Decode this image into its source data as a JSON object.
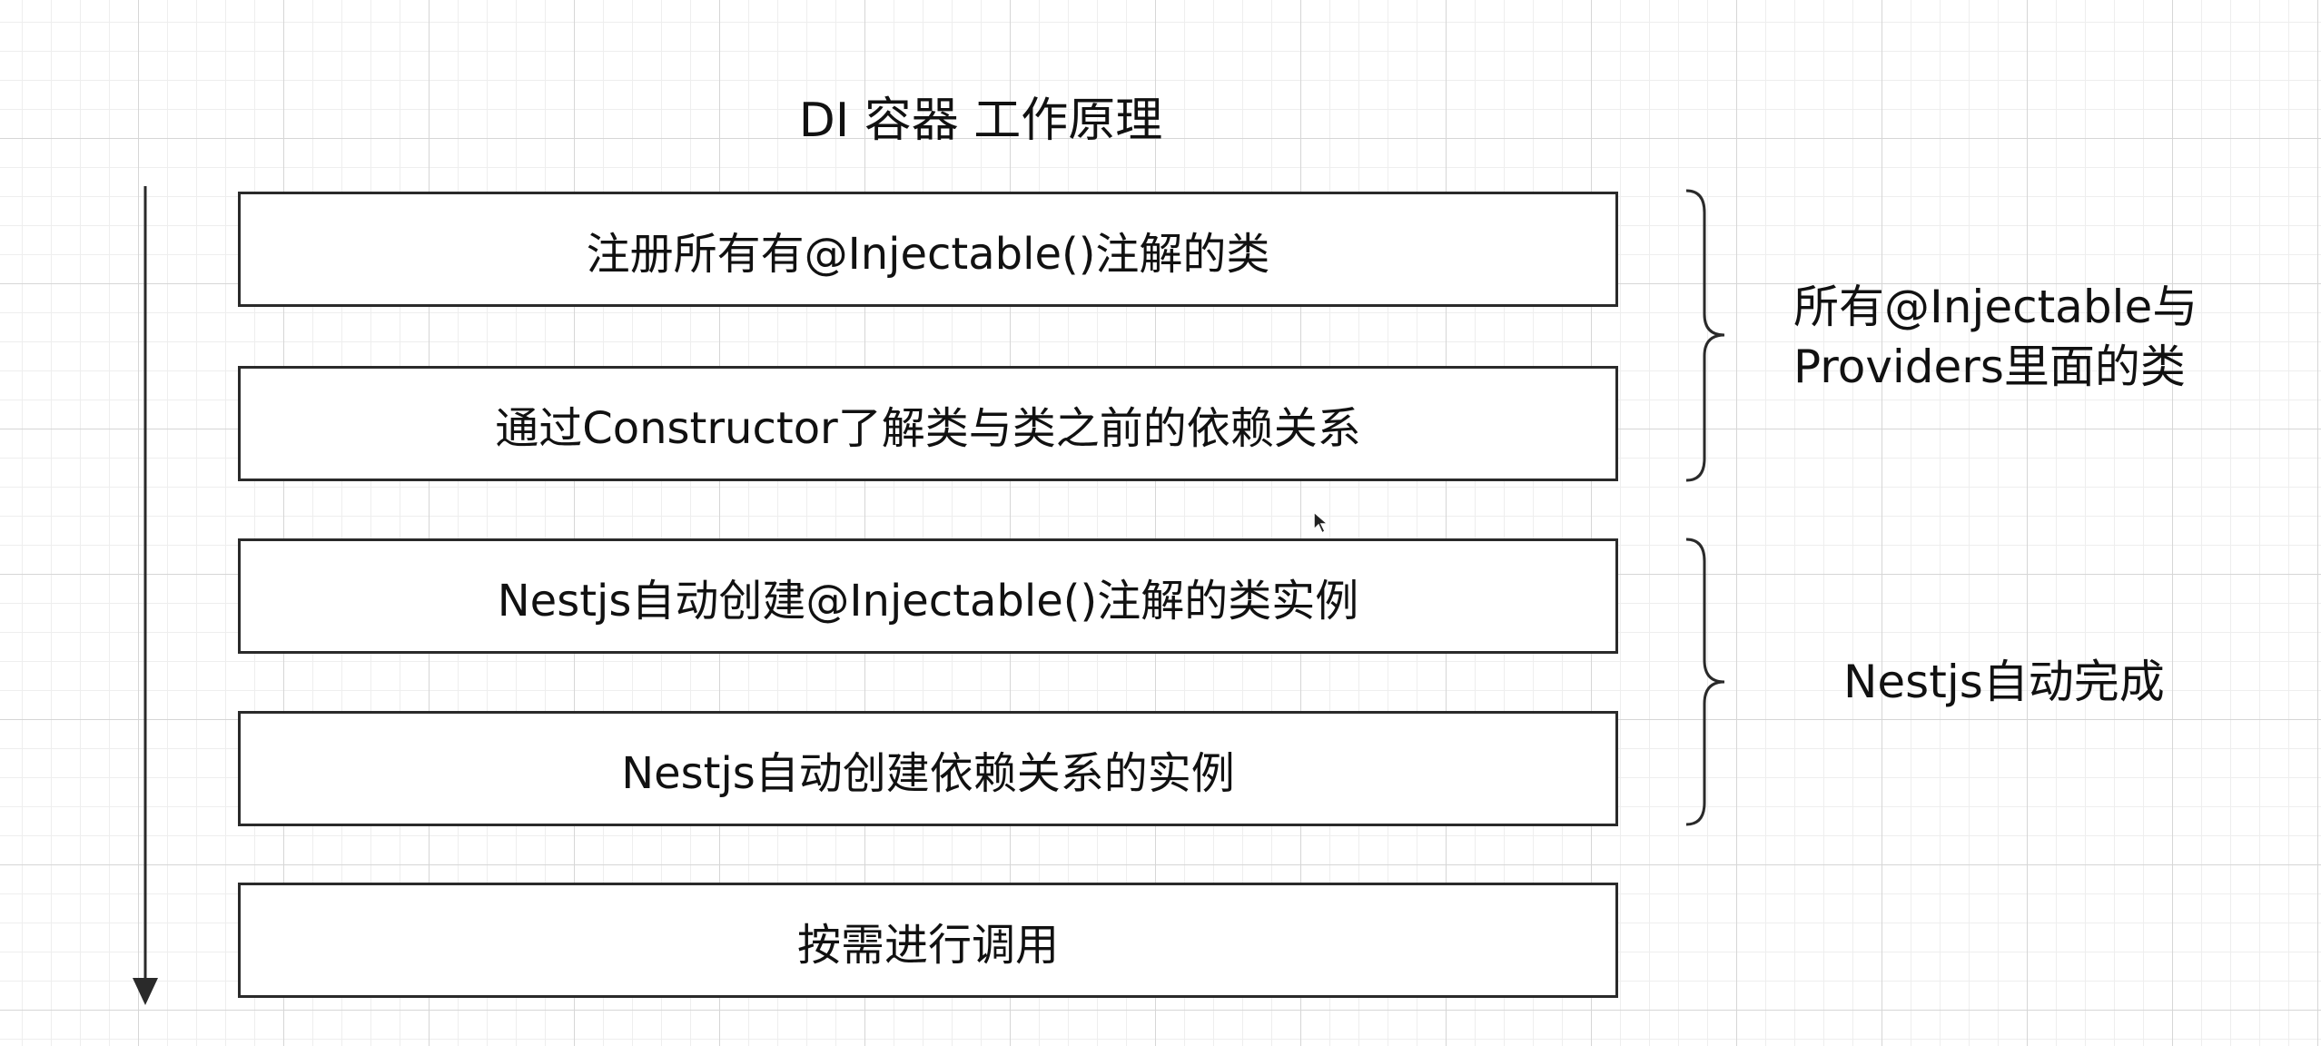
{
  "title": "DI 容器 工作原理",
  "steps": [
    "注册所有有@Injectable()注解的类",
    "通过Constructor了解类与类之前的依赖关系",
    "Nestjs自动创建@Injectable()注解的类实例",
    "Nestjs自动创建依赖关系的实例",
    "按需进行调用"
  ],
  "groups": [
    {
      "label_line1": "所有@Injectable与",
      "label_line2": "Providers里面的类"
    },
    {
      "label_line1": "Nestjs自动完成"
    }
  ],
  "colors": {
    "stroke": "#2a2a2a",
    "grid": "#d6d6d6",
    "background": "#ffffff"
  }
}
